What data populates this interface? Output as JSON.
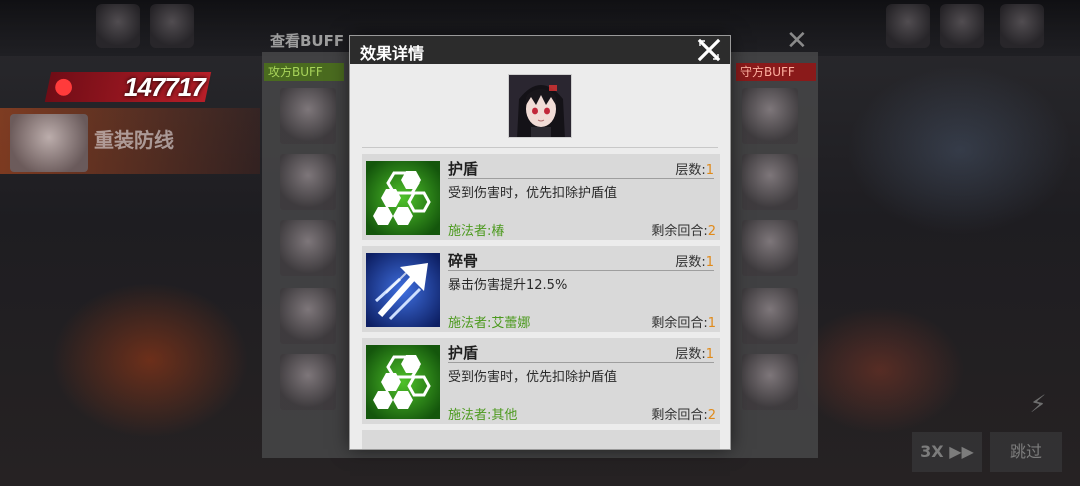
{
  "battle": {
    "damage_value": "147717",
    "boss_name": "重装防线"
  },
  "buff_panel": {
    "title": "查看BUFF",
    "attacker_label": "攻方BUFF",
    "defender_label": "守方BUFF",
    "close_glyph": "✕"
  },
  "controls": {
    "speed_label": "3X ▶▶",
    "skip_label": "跳过"
  },
  "dialog": {
    "title": "效果详情",
    "layers_label": "层数:",
    "turns_label": "剩余回合:",
    "buffs": [
      {
        "name": "护盾",
        "layers": "1",
        "description": "受到伤害时，优先扣除护盾值",
        "caster": "施法者:椿",
        "turns": "2",
        "icon": "shield-hexagon-icon"
      },
      {
        "name": "碎骨",
        "layers": "1",
        "description": "暴击伤害提升12.5%",
        "caster": "施法者:艾蕾娜",
        "turns": "1",
        "icon": "crit-arrow-icon"
      },
      {
        "name": "护盾",
        "layers": "1",
        "description": "受到伤害时，优先扣除护盾值",
        "caster": "施法者:其他",
        "turns": "2",
        "icon": "shield-hexagon-icon"
      }
    ]
  },
  "colors": {
    "caster_green": "#4d9a1f",
    "count_orange": "#e08a1a",
    "shield_icon_green": "#2f9a1a",
    "crit_icon_blue": "#1b3f9c"
  }
}
